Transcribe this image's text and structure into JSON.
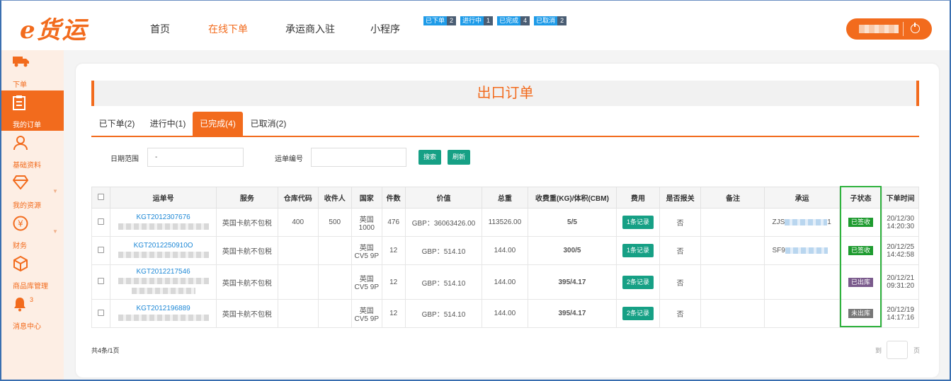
{
  "header": {
    "logo": "e货运",
    "nav": [
      "首页",
      "在线下单",
      "承运商入驻",
      "小程序"
    ],
    "badges": [
      {
        "label": "已下单",
        "count": "2"
      },
      {
        "label": "进行中",
        "count": "1"
      },
      {
        "label": "已完成",
        "count": "4"
      },
      {
        "label": "已取消",
        "count": "2"
      }
    ]
  },
  "sidebar": {
    "items": [
      {
        "label": "下单",
        "icon": "truck-icon"
      },
      {
        "label": "我的订单",
        "icon": "clipboard-icon"
      },
      {
        "label": "基础资料",
        "icon": "user-icon"
      },
      {
        "label": "我的资源",
        "icon": "diamond-icon"
      },
      {
        "label": "财务",
        "icon": "yen-icon"
      },
      {
        "label": "商品库管理",
        "icon": "box-icon"
      },
      {
        "label": "消息中心",
        "icon": "bell-icon",
        "count": "3"
      }
    ]
  },
  "page": {
    "title": "出口订单",
    "tabs": [
      "已下单(2)",
      "进行中(1)",
      "已完成(4)",
      "已取消(2)"
    ],
    "active_tab": 2
  },
  "filters": {
    "date_label": "日期范围",
    "date_value": "-",
    "waybill_label": "运单编号",
    "waybill_value": "",
    "search_button": "搜索",
    "refresh_button": "刷新"
  },
  "table": {
    "headers": [
      "运单号",
      "服务",
      "仓库代码",
      "收件人",
      "国家",
      "件数",
      "价值",
      "总重",
      "收费重(KG)/体积(CBM)",
      "费用",
      "是否报关",
      "备注",
      "承运",
      "子状态",
      "下单时间"
    ],
    "rows": [
      {
        "waybill": "KGT2012307676",
        "service": "英国卡航不包税",
        "warehouse": "400",
        "recipient": "500",
        "country": "英国",
        "country_sub": "1000",
        "pieces": "476",
        "value": "GBP：36063426.00",
        "weight": "113526.00",
        "charge": "5/5",
        "fee": "1条记录",
        "customs": "否",
        "note": "",
        "carrier": "ZJS",
        "carrier_tail": "1",
        "status": "已签收",
        "status_color": "green",
        "date": "20/12/30",
        "time": "14:20:30"
      },
      {
        "waybill": "KGT2012250910O",
        "service": "英国卡航不包税",
        "warehouse": "",
        "recipient": "",
        "country": "英国",
        "country_sub": "CV5 9P",
        "pieces": "12",
        "value": "GBP：514.10",
        "weight": "144.00",
        "charge": "300/5",
        "fee": "1条记录",
        "customs": "否",
        "note": "",
        "carrier": "SF9",
        "carrier_tail": "",
        "status": "已签收",
        "status_color": "green",
        "date": "20/12/25",
        "time": "14:42:58"
      },
      {
        "waybill": "KGT2012217546",
        "service": "英国卡航不包税",
        "warehouse": "",
        "recipient": "",
        "country": "英国",
        "country_sub": "CV5 9P",
        "pieces": "12",
        "value": "GBP：514.10",
        "weight": "144.00",
        "charge": "395/4.17",
        "fee": "2条记录",
        "customs": "否",
        "note": "",
        "carrier": "",
        "carrier_tail": "",
        "status": "已出库",
        "status_color": "purple",
        "date": "20/12/21",
        "time": "09:31:20"
      },
      {
        "waybill": "KGT2012196889",
        "service": "英国卡航不包税",
        "warehouse": "",
        "recipient": "",
        "country": "英国",
        "country_sub": "CV5 9P",
        "pieces": "12",
        "value": "GBP：514.10",
        "weight": "144.00",
        "charge": "395/4.17",
        "fee": "2条记录",
        "customs": "否",
        "note": "",
        "carrier": "",
        "carrier_tail": "",
        "status": "未出库",
        "status_color": "grey",
        "date": "20/12/19",
        "time": "14:17:16"
      }
    ]
  },
  "footer": {
    "summary": "共4条/1页",
    "goto_label": "到",
    "page_label": "页"
  },
  "colors": {
    "accent": "#f26b1d",
    "button": "#16a085",
    "link": "#1e88d6",
    "highlight": "#2fb23e"
  }
}
